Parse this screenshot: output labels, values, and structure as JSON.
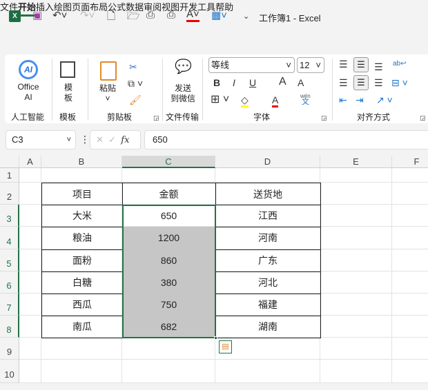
{
  "app": {
    "title": "工作簿1  -  Excel",
    "accent": "#217346"
  },
  "menu": [
    "文件",
    "开始",
    "插入",
    "绘图",
    "页面布局",
    "公式",
    "数据",
    "审阅",
    "视图",
    "开发工具",
    "帮助"
  ],
  "active_menu": "开始",
  "ribbon": {
    "ai": {
      "label1": "Office",
      "label2": "AI",
      "group": "人工智能"
    },
    "template": {
      "label1": "模",
      "label2": "板",
      "group": "模板"
    },
    "clipboard": {
      "paste": "粘贴",
      "group": "剪贴板"
    },
    "wechat": {
      "label1": "发送",
      "label2": "到微信",
      "group": "文件传输"
    },
    "font": {
      "name": "等线",
      "size": "12",
      "bold": "B",
      "italic": "I",
      "underline": "U",
      "grow": "A",
      "shrink": "A",
      "color": "A",
      "group": "字体",
      "wen": "wén",
      "wen2": "文"
    },
    "align": {
      "group": "对齐方式"
    }
  },
  "formula_bar": {
    "name_box": "C3",
    "fx": "fx",
    "value": "650"
  },
  "columns": [
    "A",
    "B",
    "C",
    "D",
    "E",
    "F"
  ],
  "rows": [
    "1",
    "2",
    "3",
    "4",
    "5",
    "6",
    "7",
    "8",
    "9",
    "10"
  ],
  "table": {
    "headers": [
      "项目",
      "金额",
      "送货地"
    ],
    "rows": [
      [
        "大米",
        "650",
        "江西"
      ],
      [
        "粮油",
        "1200",
        "河南"
      ],
      [
        "面粉",
        "860",
        "广东"
      ],
      [
        "白糖",
        "380",
        "河北"
      ],
      [
        "西瓜",
        "750",
        "福建"
      ],
      [
        "南瓜",
        "682",
        "湖南"
      ]
    ]
  }
}
